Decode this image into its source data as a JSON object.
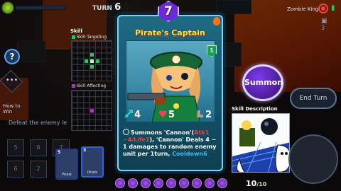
{
  "topbar": {
    "turn_label": "TURN",
    "turn_number": "6",
    "enemy_name": "Zombie King"
  },
  "left": {
    "help_label": "?",
    "menu_label": "•••",
    "how_to_win_line1": "How to",
    "how_to_win_line2": "Win",
    "objective": "Defeat the enemy le",
    "slot_numbers": [
      "5",
      "6",
      "7",
      "6",
      "2"
    ]
  },
  "skill_panel": {
    "title": "Skill",
    "targeting_label": "Skill Targeting",
    "affecting_label": "Skill Affecting",
    "targeting_color": "#22c55e",
    "affecting_color": "#c026d3"
  },
  "hand": {
    "cards": [
      {
        "cost": "5",
        "name": "Priest"
      },
      {
        "cost": "3",
        "name": "Pirate"
      }
    ]
  },
  "card": {
    "name": "Pirate's Captain",
    "cost": "7",
    "level": "1",
    "attack": "4",
    "life": "5",
    "range": "2",
    "desc_parts": [
      {
        "text": "Summons 'Cannon'(",
        "style": "plain"
      },
      {
        "text": "Atk1 ~4/Life1",
        "style": "red"
      },
      {
        "text": "), 'Cannon' Deals 4 ~ 1 damages to random enemy unit per 1turn, ",
        "style": "plain"
      },
      {
        "text": "Cooldown6",
        "style": "blue"
      }
    ],
    "frame_color": "#1f6b83",
    "title_color": "#fde047"
  },
  "actions": {
    "summon_label": "Summon",
    "end_turn_label": "End Turn",
    "skill_description_label": "Skill Description"
  },
  "counter": {
    "current": "10",
    "max": "/10"
  },
  "right_side": {
    "count": "3"
  }
}
